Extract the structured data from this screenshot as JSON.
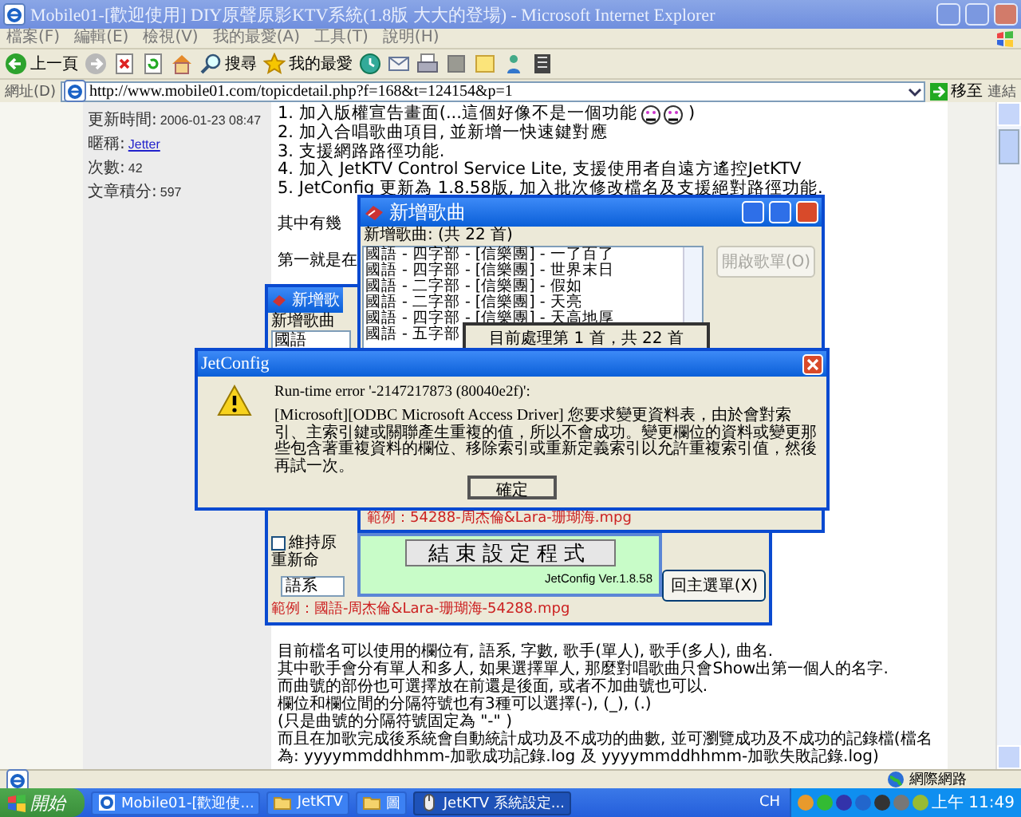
{
  "window": {
    "title": "Mobile01-[歡迎使用] DIY原聲原影KTV系統(1.8版 大大的登場) - Microsoft Internet Explorer"
  },
  "menu": [
    "檔案(F)",
    "編輯(E)",
    "檢視(V)",
    "我的最愛(A)",
    "工具(T)",
    "說明(H)"
  ],
  "toolbar": [
    {
      "kind": "back",
      "label": "上一頁"
    },
    {
      "kind": "forward"
    },
    {
      "kind": "stop"
    },
    {
      "kind": "refresh"
    },
    {
      "kind": "home"
    },
    {
      "kind": "search",
      "label": "搜尋"
    },
    {
      "kind": "favorites",
      "label": "我的最愛"
    },
    {
      "kind": "history"
    },
    {
      "kind": "mail"
    },
    {
      "kind": "print"
    },
    {
      "kind": "edit"
    },
    {
      "kind": "note"
    },
    {
      "kind": "messenger"
    },
    {
      "kind": "research"
    }
  ],
  "address": {
    "label": "網址(D)",
    "url": "http://www.mobile01.com/topicdetail.php?f=168&t=124154&p=1",
    "go": "移至",
    "links": "連結"
  },
  "post": {
    "meta": [
      {
        "label": "更新時間:",
        "value": "2006-01-23 08:47",
        "link": false
      },
      {
        "label": "暱稱:",
        "value": "Jetter",
        "link": true
      },
      {
        "label": "次數:",
        "value": "42",
        "link": false
      },
      {
        "label": "文章積分:",
        "value": "597",
        "link": false
      }
    ],
    "items": [
      {
        "text": "1. 加入版權宣告畫面(...這個好像不是一個功能",
        "emoticon": true,
        "tail": ")"
      },
      {
        "text": "2. 加入合唱歌曲項目, 並新增一快速鍵對應",
        "emoticon": false
      },
      {
        "text": "3. 支援網路路徑功能.",
        "emoticon": false
      },
      {
        "text": "4. 加入 JetKTV Control Service Lite, 支援使用者自遠方遙控JetKTV",
        "emoticon": false
      },
      {
        "text": "5. JetConfig 更新為 1.8.58版, 加入批次修改檔名及支援絕對路徑功能.",
        "emoticon": false
      }
    ],
    "fragments": [
      "其中有幾",
      "第一就是在"
    ],
    "paragraph": [
      "目前檔名可以使用的欄位有, 語系, 字數, 歌手(單人), 歌手(多人), 曲名.",
      "其中歌手會分有單人和多人, 如果選擇單人, 那麼對唱歌曲只會Show出第一個人的名字.",
      "而曲號的部份也可選擇放在前還是後面, 或者不加曲號也可以.",
      "欄位和欄位間的分隔符號也有3種可以選擇(-), (_), (.)",
      "(只是曲號的分隔符號固定為 \"-\" )",
      "而且在加歌完成後系統會自動統計成功及不成功的曲數, 並可瀏覽成功及不成功的記錄檔(檔名為: yyyymmddhhmm-加歌成功記錄.log 及 yyyymmddhhmm-加歌失敗記錄.log)"
    ]
  },
  "back_window": {
    "title": "新增歌",
    "label": "新增歌曲",
    "row": "國語",
    "checkbox": {
      "label": "維持原",
      "checked": false
    },
    "group": "重新命",
    "field": "語系",
    "example": "範例：國語-周杰倫&Lara-珊瑚海-54288.mpg",
    "button": "回主選單(X)"
  },
  "song_dialog": {
    "title": "新增歌曲",
    "count": "新增歌曲: (共 22 首)",
    "songs": [
      "國語 - 四字部 - [信樂團] - 一了百了",
      "國語 - 四字部 - [信樂團] - 世界末日",
      "國語 - 二字部 - [信樂團] - 假如",
      "國語 - 二字部 - [信樂團] - 天亮",
      "國語 - 四字部 - [信樂團] - 天高地厚",
      "國語 - 五字部"
    ],
    "open_button": {
      "label": "開啟歌單(O)",
      "disabled": true
    },
    "example": "範例：54288-周杰倫&Lara-珊瑚海.mpg"
  },
  "progress": {
    "text": "目前處理第 1 首，共 22 首"
  },
  "finish_panel": {
    "button": "結束設定程式",
    "version": "JetConfig Ver.1.8.58"
  },
  "error_dialog": {
    "title": "JetConfig",
    "error": "Run-time error '-2147217873 (80040e2f)':",
    "message": "[Microsoft][ODBC Microsoft Access Driver] 您要求變更資料表，由於會對索引、主索引鍵或關聯產生重複的值，所以不會成功。變更欄位的資料或變更那些包含著重複資料的欄位、移除索引或重新定義索引以允許重複索引值，然後再試一次。",
    "ok": "確定"
  },
  "status_bar": {
    "zone": "網際網路"
  },
  "taskbar": {
    "start": "開始",
    "tasks": [
      {
        "label": "Mobile01-[歡迎使...",
        "kind": "ie",
        "selected": false
      },
      {
        "label": "JetKTV",
        "kind": "folder",
        "selected": false
      },
      {
        "label": "圖",
        "kind": "folder",
        "selected": false
      },
      {
        "label": "JetKTV 系統設定...",
        "kind": "app",
        "selected": true
      }
    ],
    "lang": "CH",
    "clock": "上午 11:49"
  }
}
